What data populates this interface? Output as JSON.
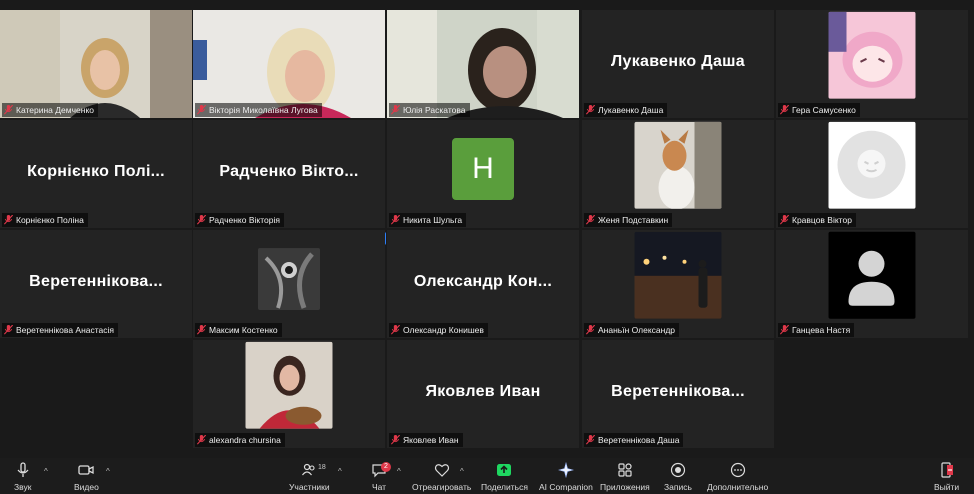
{
  "participants": [
    {
      "display": "",
      "label": "Катерина Демченко"
    },
    {
      "display": "",
      "label": "Вікторія Миколаївна Лугова"
    },
    {
      "display": "",
      "label": "Юлія Раскатова"
    },
    {
      "display": "Лукавенко Даша",
      "label": "Лукавенко Даша"
    },
    {
      "display": "",
      "label": "Гера Самусенко"
    },
    {
      "display": "Корнієнко Полі...",
      "label": "Корнієнко Поліна"
    },
    {
      "display": "Радченко Вікто...",
      "label": "Радченко Вікторія"
    },
    {
      "display": "H",
      "label": "Никита Шульга"
    },
    {
      "display": "",
      "label": "Женя Подставкин"
    },
    {
      "display": "",
      "label": "Кравцов Віктор"
    },
    {
      "display": "Веретеннікова...",
      "label": "Веретеннікова Анастасія"
    },
    {
      "display": "",
      "label": "Максим Костенко"
    },
    {
      "display": "Олександр Кон...",
      "label": "Олександр Конишев"
    },
    {
      "display": "",
      "label": "Ананьїн Олександр"
    },
    {
      "display": "",
      "label": "Ганцева Настя"
    },
    {
      "display": "",
      "label": "alexandra chursina"
    },
    {
      "display": "Яковлев Иван",
      "label": "Яковлев Иван"
    },
    {
      "display": "Веретеннікова...",
      "label": "Веретеннікова Даша"
    }
  ],
  "toolbar": {
    "audio": "Звук",
    "video": "Видео",
    "participants": "Участники",
    "participants_count": "18",
    "chat": "Чат",
    "chat_badge": "2",
    "react": "Отреагировать",
    "share": "Поделиться",
    "ai": "AI Companion",
    "apps": "Приложения",
    "record": "Запись",
    "more": "Дополнительно",
    "leave": "Выйти"
  },
  "more_dots": "···",
  "colors": {
    "active_border": "#2fd26d",
    "share_green": "#1ed760",
    "avatar_green": "#5a9e3c",
    "leave_red": "#e0384a"
  }
}
